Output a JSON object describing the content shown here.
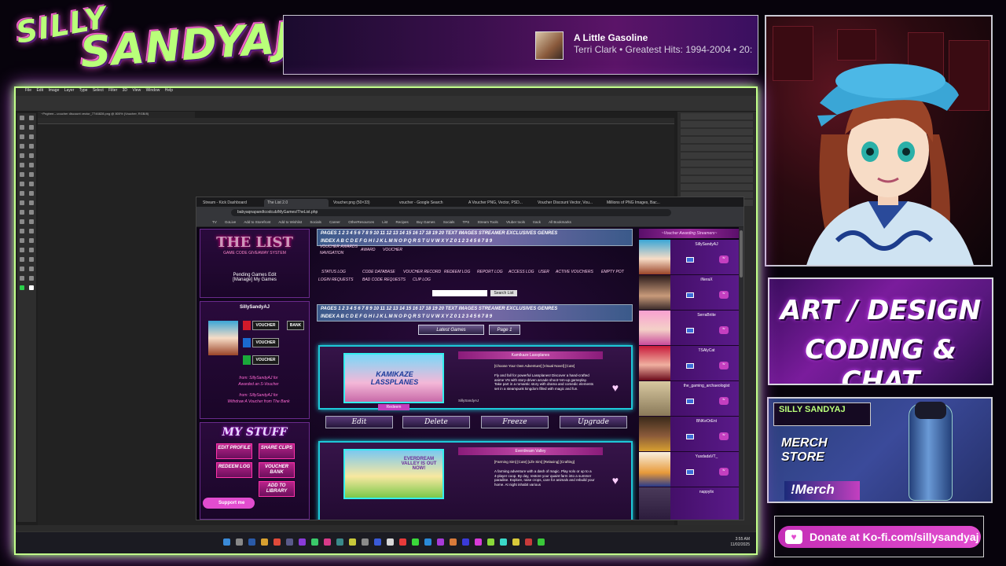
{
  "overlay": {
    "logo_line1": "SILLY",
    "logo_line2": "SANDYAJ",
    "now_playing": {
      "title": "A Little Gasoline",
      "subtitle": "Terri Clark • Greatest Hits: 1994-2004 • 20:"
    },
    "panel_art_line1": "ART / DESIGN",
    "panel_art_line2": "CODING & CHAT",
    "merch": {
      "logo": "SILLY SANDYAJ",
      "line1": "MERCH",
      "line2": "STORE",
      "command": "!Merch"
    },
    "kofi": "Donate at Ko-fi.com/sillysandyaj"
  },
  "photoshop": {
    "menu": [
      "File",
      "Edit",
      "Image",
      "Layer",
      "Type",
      "Select",
      "Filter",
      "3D",
      "View",
      "Window",
      "Help"
    ],
    "doc_tab": "~Pngtree---voucher discount vector_7746828.png @ 800% (Voucher, RGB/8)"
  },
  "browser": {
    "tabs": [
      "Stream - Kick Dashboard",
      "The List 2.0",
      "Voucher.png (50×33)",
      "voucher - Google Search",
      "A Voucher PNG, Vector, PSD...",
      "Voucher Discount Vector, Vou...",
      "Millions of PNG Images, Bac..."
    ],
    "url": "babyaqnapandtcodcub/MyGames/TheList.php",
    "bookmarks": [
      "TV",
      "GoLive",
      "Add to Storefront",
      "Add to Wishlist",
      "Socials",
      "Career",
      "OtherResources",
      "List",
      "Recipes",
      "Buy Games",
      "Socials",
      "TPS",
      "Stream Tools",
      "Vtuber tools",
      "track"
    ],
    "bookmarks_all": "All Bookmarks"
  },
  "page": {
    "logo": "THE LIST",
    "logo_sub": "GAME CODE GIVEAWAY SYSTEM",
    "pending": "Pending Games Edit",
    "manage": "[Manage] My Games",
    "user": "SillySandyAJ",
    "voucher_labels": [
      "VOUCHER",
      "VOUCHER",
      "VOUCHER"
    ],
    "bank_label": "BANK",
    "awarded_line": "from: SillySandyAJ for",
    "awarded_text": "Awarded an S-Voucher",
    "withdraw_line": "from: SillySandyAJ for",
    "withdraw_text": "Withdraw A Voucher from The Bank",
    "my_stuff": "MY STUFF",
    "stuff_buttons": [
      "EDIT PROFILE",
      "SHARE CLIPS",
      "REDEEM LOG",
      "VOUCHER BANK",
      "ADD TO LIBRARY"
    ],
    "support": "Support me",
    "nav_row1": "PAGES  1 2 3 4 5 6 7 8 9 10 11 12 13 14 15 16 17 18 19 20   TEXT  IMAGES  STREAMER EXCLUSIVES  GENRES",
    "nav_row2": "INDEX  A B C D E F G H I J K L M N O P Q R S T U V W X Y Z 0 1 2 3 4 5 6 7 8 9",
    "links": [
      "VOUCHER AWARDS",
      "NAVIGATION",
      "AWARD",
      "VOUCHER",
      "STATUS LOG",
      "CODE DATABASE",
      "VOUCHER RECORD",
      "REDEEM LOG",
      "REPORT LOG",
      "ACCESS LOG",
      "USER",
      "ACTIVE VOUCHERS",
      "EMPTY POT",
      "LOGIN REQUESTS",
      "BAD CODE REQUESTS",
      "CLIP LOG"
    ],
    "search_button": "Search List",
    "latest_games": "Latest Games",
    "page_label": "Page 1",
    "card1": {
      "title": "Kamikaze Lassplanes",
      "genre": "[Choose Your Own Adventure] [Visual Novel] [Cute]",
      "desc": "Fly and fall for powerful Lassplanes! Discover a hand-crafted anime VN with story-driven arcade shoot-'em-up gameplay. Take part in a romantic story with drama and comedic elements set in a steampunk kingdom filled with magic and fun.",
      "thumb_text": "KAMIKAZE LASSPLANES",
      "by": "SillySandyAJ",
      "redeem": "Redeem"
    },
    "actions": [
      "Edit",
      "Delete",
      "Freeze",
      "Upgrade"
    ],
    "card2": {
      "title": "Everdream Valley",
      "genre": "[Farming Sim] [Cute] [Life Sim] [Relaxing] [Crafting]",
      "desc": "A farming adventure with a dash of magic. Play solo or up to a 4-player coop. By day, restore your quaint farm into a summer paradise. Explore, raise crops, care for animals and rebuild your home. At night inhabit various",
      "thumb_text": "EVERDREAM VALLEY IS OUT NOW!"
    },
    "right_header": "~Voucher Awarding Streamers~",
    "streamers": [
      "SillySandyAJ",
      "iNeraX",
      "SerraBriite",
      "TSAlyCat",
      "the_gaming_archaeologist",
      "BNKeOrEnt",
      "YusdadaVT_",
      "nappylix"
    ]
  },
  "taskbar": {
    "time": "3:55 AM",
    "date": "11/02/2025"
  }
}
